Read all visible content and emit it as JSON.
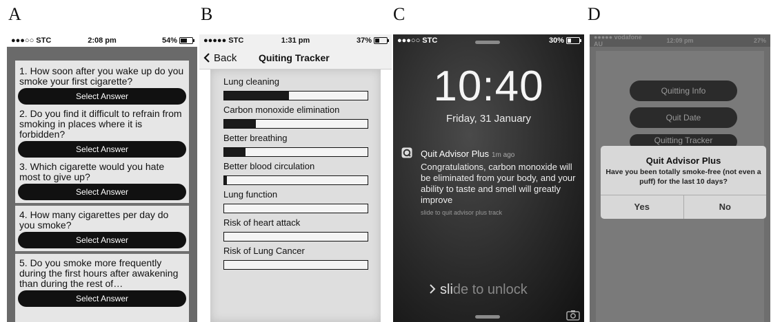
{
  "panels": {
    "a": {
      "letter": "A",
      "status": {
        "carrier": "●●●○○ STC",
        "time": "2:08 pm",
        "battery": "54%",
        "battery_level": 0.54
      },
      "questions": [
        {
          "text": "1. How soon after you wake up do you smoke your first cigarette?",
          "button": "Select Answer"
        },
        {
          "text": "2. Do you find it difficult to refrain from smoking in places where it is forbidden?",
          "button": "Select Answer"
        },
        {
          "text": "3. Which cigarette would you hate most to give up?",
          "button": "Select Answer"
        },
        {
          "text": "4. How many cigarettes per day do you smoke?",
          "button": "Select Answer"
        },
        {
          "text": "5. Do you smoke more frequently during the first hours after awakening than during the rest of…",
          "button": "Select Answer"
        }
      ]
    },
    "b": {
      "letter": "B",
      "status": {
        "carrier": "●●●●● STC",
        "time": "1:31 pm",
        "battery": "37%",
        "battery_level": 0.37
      },
      "nav": {
        "back": "Back",
        "title": "Quiting Tracker"
      },
      "items": [
        {
          "label": "Lung cleaning",
          "progress": 0.45
        },
        {
          "label": "Carbon monoxide elimination",
          "progress": 0.22
        },
        {
          "label": "Better breathing",
          "progress": 0.15
        },
        {
          "label": "Better blood circulation",
          "progress": 0.02
        },
        {
          "label": "Lung function",
          "progress": 0
        },
        {
          "label": "Risk of heart attack",
          "progress": 0
        },
        {
          "label": "Risk of Lung Cancer",
          "progress": 0
        }
      ]
    },
    "c": {
      "letter": "C",
      "status": {
        "carrier": "●●●○○ STC",
        "battery": "30%",
        "battery_level": 0.3
      },
      "time": "10:40",
      "date": "Friday, 31 January",
      "notification": {
        "app": "Quit Advisor Plus",
        "ago": "1m ago",
        "body": "Congratulations, carbon monoxide will be eliminated from your body, and your ability to taste and smell will greatly improve",
        "slide": "slide to quit advisor plus track"
      },
      "unlock": {
        "bright": "sli",
        "dim": "de to unlock"
      },
      "icons": {
        "app": "quit-advisor-app-icon",
        "camera": "camera-icon"
      }
    },
    "d": {
      "letter": "D",
      "status": {
        "carrier": "●●●●● vodafone AU",
        "time": "12:09 pm",
        "battery": "27%"
      },
      "buttons": [
        "Quitting Info",
        "Quit Date",
        "Quitting Tracker"
      ],
      "alert": {
        "title": "Quit Advisor Plus",
        "message": "Have you been totally smoke-free (not even a puff) for the last 10 days?",
        "yes": "Yes",
        "no": "No"
      }
    }
  }
}
